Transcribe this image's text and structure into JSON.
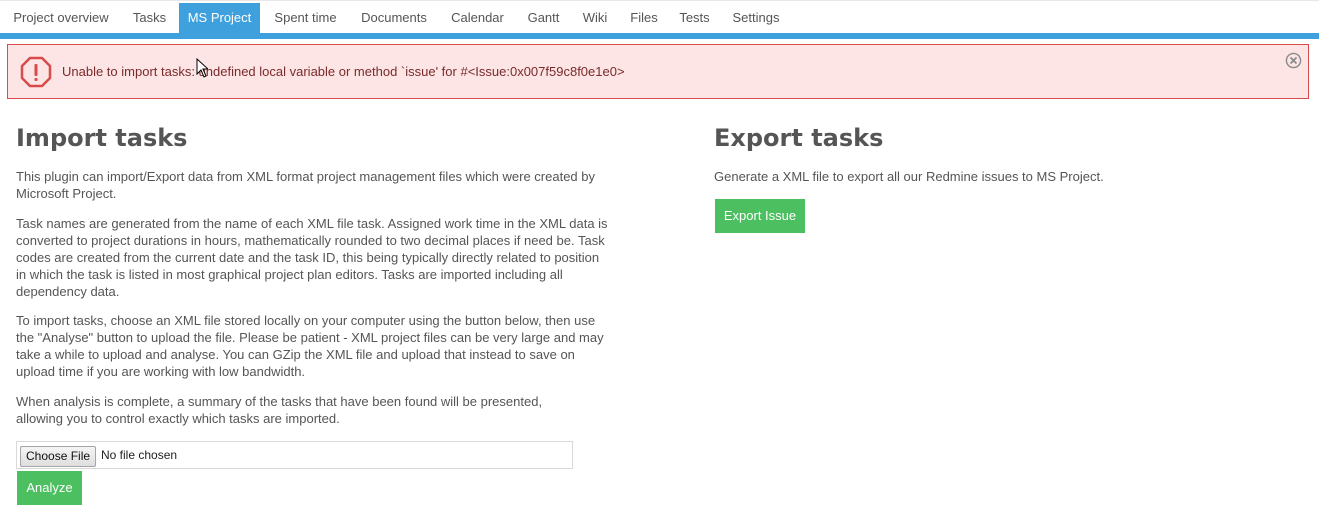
{
  "tabs": [
    {
      "label": "Project overview",
      "active": false
    },
    {
      "label": "Tasks",
      "active": false
    },
    {
      "label": "MS Project",
      "active": true
    },
    {
      "label": "Spent time",
      "active": false
    },
    {
      "label": "Documents",
      "active": false
    },
    {
      "label": "Calendar",
      "active": false
    },
    {
      "label": "Gantt",
      "active": false
    },
    {
      "label": "Wiki",
      "active": false
    },
    {
      "label": "Files",
      "active": false
    },
    {
      "label": "Tests",
      "active": false
    },
    {
      "label": "Settings",
      "active": false
    }
  ],
  "flash": {
    "icon": "error-icon",
    "message": "Unable to import tasks: undefined local variable or method `issue' for #<Issue:0x007f59c8f0e1e0>",
    "close_icon": "close-circle-icon"
  },
  "import": {
    "title": "Import tasks",
    "paragraphs": [
      "This plugin can import/Export data from XML format project management files which were created by Microsoft Project.",
      "Task names are generated from the name of each XML file task. Assigned work time in the XML data is converted to project durations in hours, mathematically rounded to two decimal places if need be. Task codes are created from the current date and the task ID, this being typically directly related to position in which the task is listed in most graphical project plan editors. Tasks are imported including all dependency data.",
      "To import tasks, choose an XML file stored locally on your computer using the button below, then use the \"Analyse\" button to upload the file. Please be patient - XML project files can be very large and may take a while to upload and analyse. You can GZip the XML file and upload that instead to save on upload time if you are working with low bandwidth.",
      "When analysis is complete, a summary of the tasks that have been found will be presented, allowing you to control exactly which tasks are imported."
    ],
    "choose_file_label": "Choose File",
    "file_status": "No file chosen",
    "analyze_label": "Analyze"
  },
  "export": {
    "title": "Export tasks",
    "description": "Generate a XML file to export all our Redmine issues to MS Project.",
    "button_label": "Export Issue"
  },
  "colors": {
    "accent": "#3ea0dc",
    "button": "#4cbf61",
    "error_bg": "#fde5e5",
    "error_border": "#d94a4a"
  }
}
